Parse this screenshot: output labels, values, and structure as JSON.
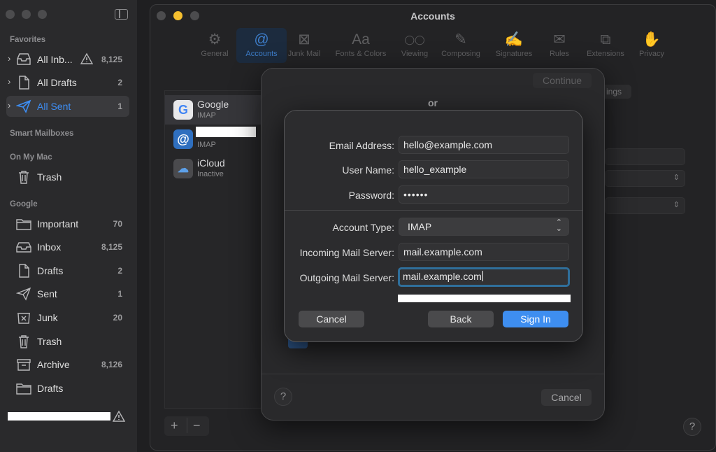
{
  "sidebar": {
    "favorites_header": "Favorites",
    "favorites": [
      {
        "label": "All Inb...",
        "count": "8,125",
        "icon": "inbox-tray-icon",
        "warning": true
      },
      {
        "label": "All Drafts",
        "count": "2",
        "icon": "document-icon"
      },
      {
        "label": "All Sent",
        "count": "1",
        "icon": "paper-plane-icon",
        "selected": true
      }
    ],
    "smart_header": "Smart Mailboxes",
    "onmymac_header": "On My Mac",
    "onmymac": [
      {
        "label": "Trash",
        "count": "",
        "icon": "trash-icon"
      }
    ],
    "google_header": "Google",
    "google": [
      {
        "label": "Important",
        "count": "70",
        "icon": "folder-icon"
      },
      {
        "label": "Inbox",
        "count": "8,125",
        "icon": "inbox-tray-icon"
      },
      {
        "label": "Drafts",
        "count": "2",
        "icon": "document-icon"
      },
      {
        "label": "Sent",
        "count": "1",
        "icon": "paper-plane-icon"
      },
      {
        "label": "Junk",
        "count": "20",
        "icon": "junk-icon"
      },
      {
        "label": "Trash",
        "count": "",
        "icon": "trash-icon"
      },
      {
        "label": "Archive",
        "count": "8,126",
        "icon": "archive-box-icon"
      },
      {
        "label": "Drafts",
        "count": "",
        "icon": "folder-icon"
      }
    ]
  },
  "window": {
    "title": "Accounts",
    "toolbar": [
      {
        "label": "General",
        "glyph": "⚙",
        "icon": "gear-icon"
      },
      {
        "label": "Accounts",
        "glyph": "@",
        "icon": "at-sign-icon",
        "active": true
      },
      {
        "label": "Junk Mail",
        "glyph": "⊠",
        "icon": "junk-mail-icon"
      },
      {
        "label": "Fonts & Colors",
        "glyph": "Aa",
        "icon": "fonts-icon"
      },
      {
        "label": "Viewing",
        "glyph": "◯◯",
        "icon": "glasses-icon"
      },
      {
        "label": "Composing",
        "glyph": "✎",
        "icon": "compose-icon"
      },
      {
        "label": "Signatures",
        "glyph": "✍",
        "icon": "signature-icon"
      },
      {
        "label": "Rules",
        "glyph": "✉",
        "icon": "rules-icon"
      },
      {
        "label": "Extensions",
        "glyph": "⧉",
        "icon": "extensions-icon"
      },
      {
        "label": "Privacy",
        "glyph": "✋",
        "icon": "hand-icon"
      }
    ],
    "accounts": [
      {
        "name": "Google",
        "type": "IMAP",
        "icon": "google-logo-icon",
        "selected": true
      },
      {
        "name": "",
        "type": "IMAP",
        "icon": "at-sign-icon"
      },
      {
        "name": "iCloud",
        "type": "Inactive",
        "icon": "cloud-icon"
      }
    ],
    "add_label": "+",
    "remove_label": "−",
    "help_label": "?",
    "settings_fragment": "ings"
  },
  "sheet1": {
    "continue_label": "Continue",
    "or_text": "or",
    "help_label": "?",
    "cancel_label": "Cancel"
  },
  "sheet2": {
    "email_label": "Email Address:",
    "email_value": "hello@example.com",
    "username_label": "User Name:",
    "username_value": "hello_example",
    "password_label": "Password:",
    "password_value": "••••••",
    "account_type_label": "Account Type:",
    "account_type_value": "IMAP",
    "incoming_label": "Incoming Mail Server:",
    "incoming_value": "mail.example.com",
    "outgoing_label": "Outgoing Mail Server:",
    "outgoing_value": "mail.example.com",
    "cancel_label": "Cancel",
    "back_label": "Back",
    "signin_label": "Sign In"
  },
  "colors": {
    "accent": "#3e8ef0",
    "selected_sidebar_text": "#3d8ef5",
    "close_light": "#4c4c4e",
    "minimize_light": "#f5bf2f"
  }
}
